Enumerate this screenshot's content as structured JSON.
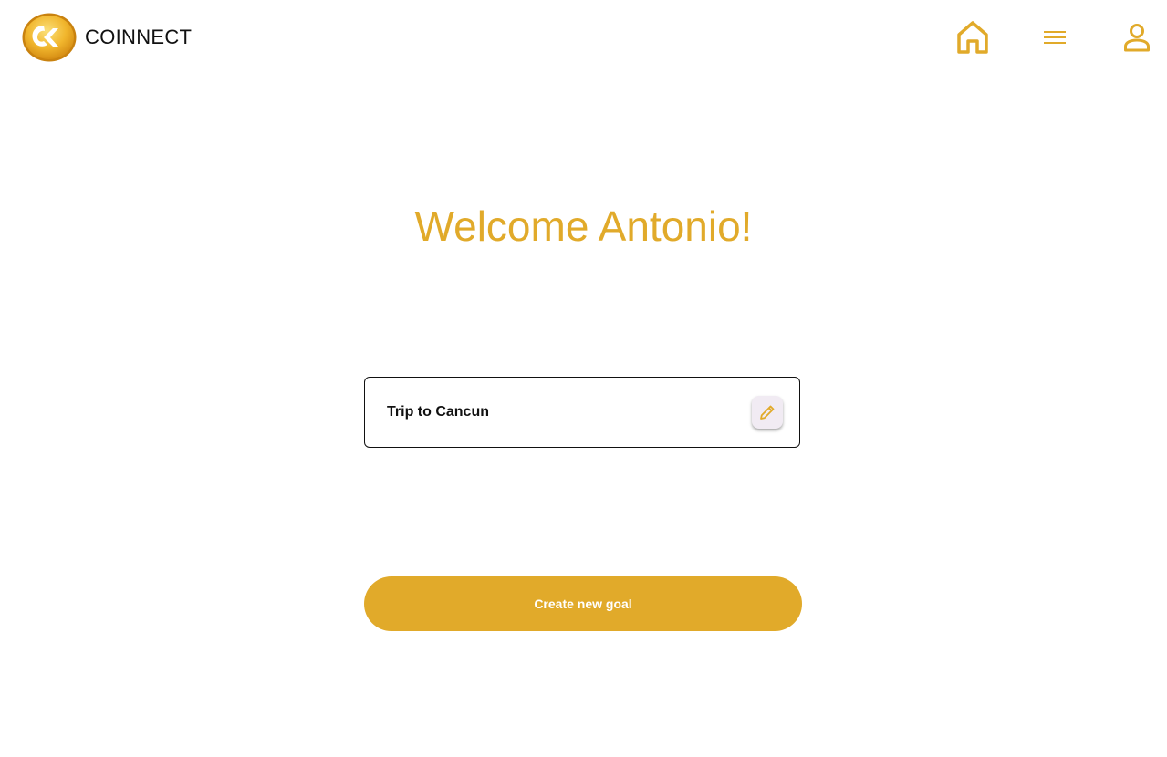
{
  "header": {
    "brand_name": "COINNECT",
    "logo_icon": "coinnect-coin-logo",
    "nav": [
      {
        "name": "home",
        "icon": "home-icon"
      },
      {
        "name": "menu",
        "icon": "menu-icon"
      },
      {
        "name": "profile",
        "icon": "user-icon"
      }
    ]
  },
  "main": {
    "welcome_text": "Welcome Antonio!",
    "goals": [
      {
        "title": "Trip to Cancun",
        "action_icon": "pencil-icon"
      }
    ],
    "create_button_label": "Create new goal"
  },
  "colors": {
    "accent": "#E1AA2A",
    "text": "#111111",
    "edit_button_bg": "#F1EBF3"
  }
}
